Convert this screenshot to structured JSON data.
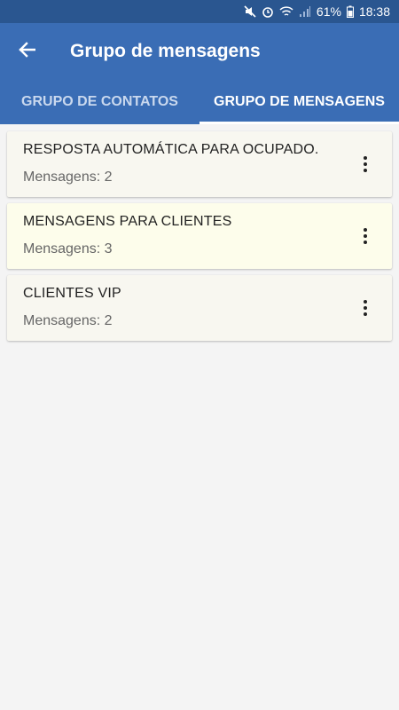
{
  "status_bar": {
    "battery": "61%",
    "time": "18:38",
    "icons": [
      "mute-icon",
      "alarm-icon",
      "wifi-icon",
      "signal-icon",
      "battery-icon"
    ]
  },
  "app_bar": {
    "title": "Grupo de mensagens",
    "back_icon": "arrow-left-icon"
  },
  "tabs": [
    {
      "label": "GRUPO DE CONTATOS",
      "active": false
    },
    {
      "label": "GRUPO DE MENSAGENS",
      "active": true
    }
  ],
  "groups": [
    {
      "name": "RESPOSTA AUTOMÁTICA PARA OCUPADO.",
      "count": "Mensagens: 2",
      "bg": "#f8f7f0"
    },
    {
      "name": "MENSAGENS PARA CLIENTES",
      "count": "Mensagens: 3",
      "bg": "#fdfdeb"
    },
    {
      "name": "CLIENTES VIP",
      "count": "Mensagens: 2",
      "bg": "#f8f7f0"
    }
  ],
  "colors": {
    "primary": "#3a6db5",
    "status_bar": "#2a5690"
  }
}
